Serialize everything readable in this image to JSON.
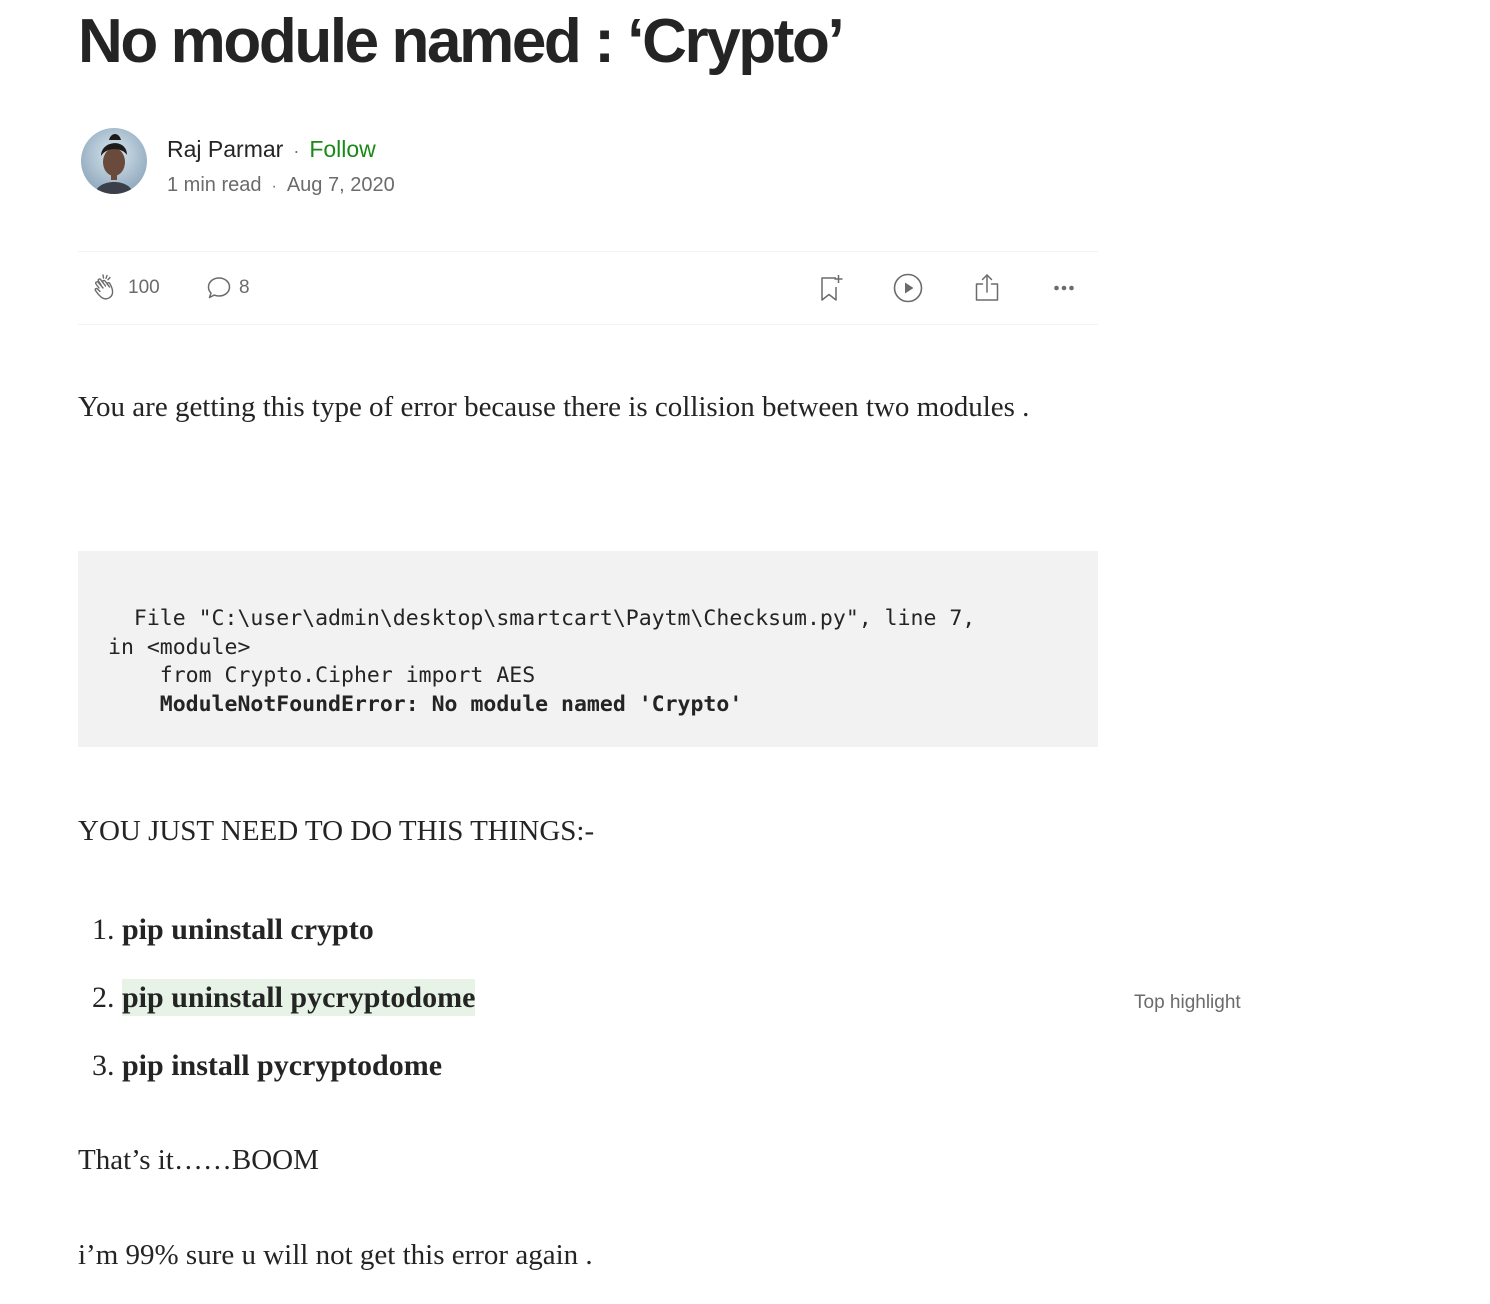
{
  "article": {
    "title": "No module named : ‘Crypto’",
    "author": {
      "name": "Raj Parmar",
      "separator": "·",
      "follow_label": "Follow",
      "read_time": "1 min read",
      "date": "Aug 7, 2020"
    },
    "actions": {
      "claps": "100",
      "responses": "8",
      "icons": [
        "clap-icon",
        "comment-icon",
        "bookmark-icon",
        "play-icon",
        "share-icon",
        "more-icon"
      ]
    },
    "intro_text": "You are getting this type of error because there is collision between two modules .",
    "code": {
      "line1": "  File \"C:\\user\\admin\\desktop\\smartcart\\Paytm\\Checksum.py\", line 7,",
      "line2": "in <module>",
      "line3": "    from Crypto.Cipher import AES",
      "line4_prefix": "    ",
      "line4_bold": "ModuleNotFoundError: No module named 'Crypto'"
    },
    "steps_heading": "YOU JUST NEED TO DO THIS THINGS:-",
    "steps": [
      {
        "num": "1.",
        "text": "pip uninstall crypto"
      },
      {
        "num": "2.",
        "text": "pip uninstall pycryptodome"
      },
      {
        "num": "3.",
        "text": "pip install pycryptodome"
      }
    ],
    "top_highlight_label": "Top highlight",
    "outro_1": "That’s it……BOOM",
    "outro_2": "i’m 99% sure u will not get this error again ."
  },
  "colors": {
    "text": "#242424",
    "muted": "#6b6b6b",
    "follow": "#1a8917",
    "code_bg": "#f2f2f2",
    "highlight": "#e6f3e6"
  }
}
